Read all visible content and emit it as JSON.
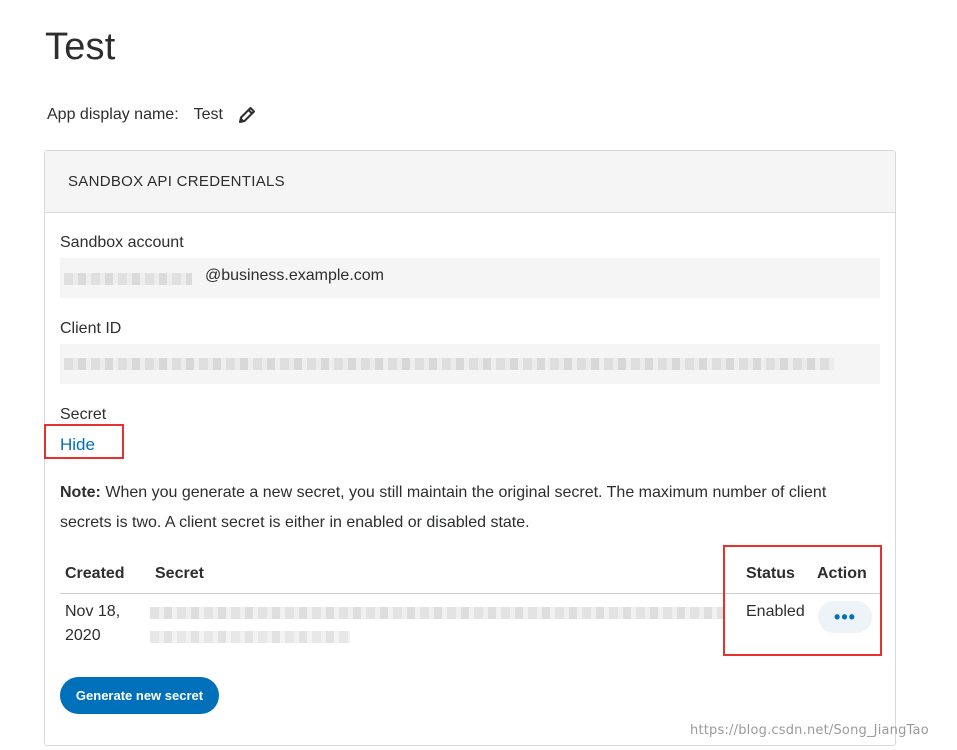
{
  "page": {
    "title": "Test"
  },
  "app_display_name": {
    "label": "App display name:",
    "value": "Test",
    "edit_icon": "pencil-icon"
  },
  "credentials": {
    "header": "SANDBOX API CREDENTIALS",
    "sandbox_account": {
      "label": "Sandbox account",
      "email_domain": "@business.example.com"
    },
    "client_id": {
      "label": "Client ID"
    },
    "secret": {
      "label": "Secret",
      "hide_link": "Hide"
    },
    "note": {
      "bold": "Note:",
      "text": " When you generate a new secret, you still maintain the original secret. The maximum number of client secrets is two. A client secret is either in enabled or disabled state."
    },
    "table": {
      "headers": {
        "created": "Created",
        "secret": "Secret",
        "status": "Status",
        "action": "Action"
      },
      "rows": [
        {
          "created": "Nov 18, 2020",
          "status": "Enabled",
          "action_icon": "more-horizontal-icon"
        }
      ]
    },
    "generate_button": "Generate new secret"
  },
  "watermark": "https://blog.csdn.net/Song_JiangTao",
  "colors": {
    "link": "#0070ba",
    "primary_button": "#0070ba",
    "highlight_box": "#e5322d"
  }
}
